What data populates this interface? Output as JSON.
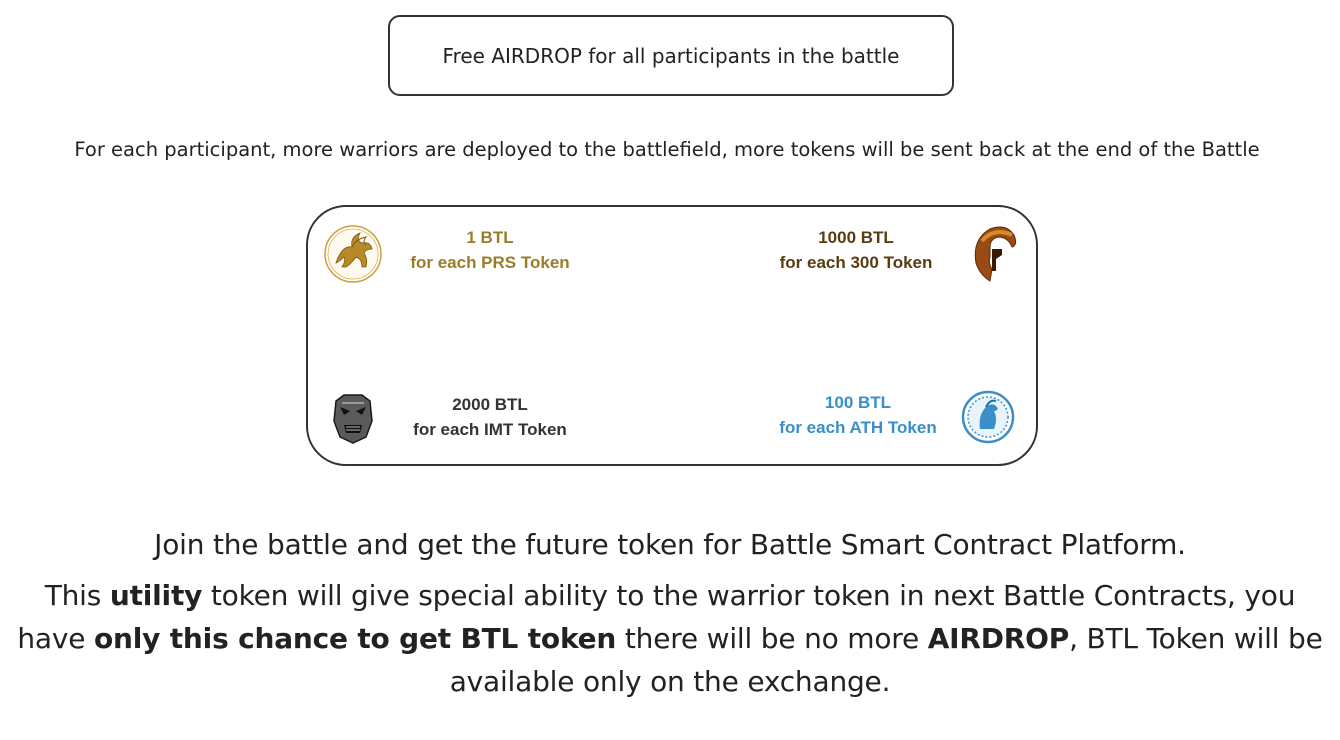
{
  "banner": {
    "text": "Free AIRDROP for all participants in the battle"
  },
  "subtitle": "For each participant, more warriors are deployed to the battlefield, more tokens will be sent back at the end of the Battle",
  "rewards": {
    "prs": {
      "amount": "1 BTL",
      "per": "for each PRS Token",
      "color": "#9a7d2a",
      "icon": "griffin-emblem-icon"
    },
    "t300": {
      "amount": "1000 BTL",
      "per": "for each 300 Token",
      "color": "#5a3c10",
      "icon": "spartan-helmet-icon"
    },
    "imt": {
      "amount": "2000 BTL",
      "per": "for each IMT Token",
      "color": "#333333",
      "icon": "samurai-mask-icon"
    },
    "ath": {
      "amount": "100 BTL",
      "per": "for each ATH Token",
      "color": "#3a8fc9",
      "icon": "athena-medallion-icon"
    }
  },
  "message": {
    "line1": "Join the battle and get the future token for Battle Smart Contract Platform.",
    "p2_a": "This ",
    "p2_b": "utility",
    "p2_c": " token will give special ability to the warrior token in next Battle Contracts, you",
    "p3_a": "have ",
    "p3_b": "only this chance to get BTL token",
    "p3_c": " there will be no more ",
    "p3_d": "AIRDROP",
    "p3_e": ", BTL Token will be",
    "p4": "available only on the exchange."
  }
}
